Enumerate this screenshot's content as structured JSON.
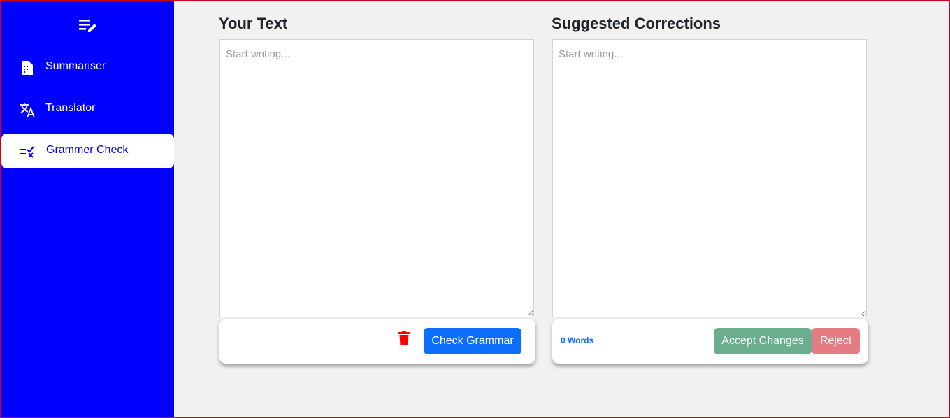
{
  "sidebar": {
    "brand_icon": "notes-edit-icon",
    "background": "#0000ff",
    "items": [
      {
        "label": "Summariser",
        "icon": "summary-doc-icon"
      },
      {
        "label": "Translator",
        "icon": "translate-icon"
      },
      {
        "label": "Grammer Check",
        "icon": "grammar-check-icon",
        "active": true
      }
    ]
  },
  "input_panel": {
    "title": "Your Text",
    "placeholder": "Start writing...",
    "value": "",
    "delete_icon": "trash-icon",
    "check_button": "Check Grammar"
  },
  "output_panel": {
    "title": "Suggested Corrections",
    "placeholder": "Start writing...",
    "value": "",
    "word_count": "0 Words",
    "accept_button": "Accept Changes",
    "reject_button": "Reject"
  },
  "colors": {
    "primary": "#0d6efd",
    "success": "#6aae8f",
    "danger": "#e57c84",
    "trash": "#ff0000"
  }
}
